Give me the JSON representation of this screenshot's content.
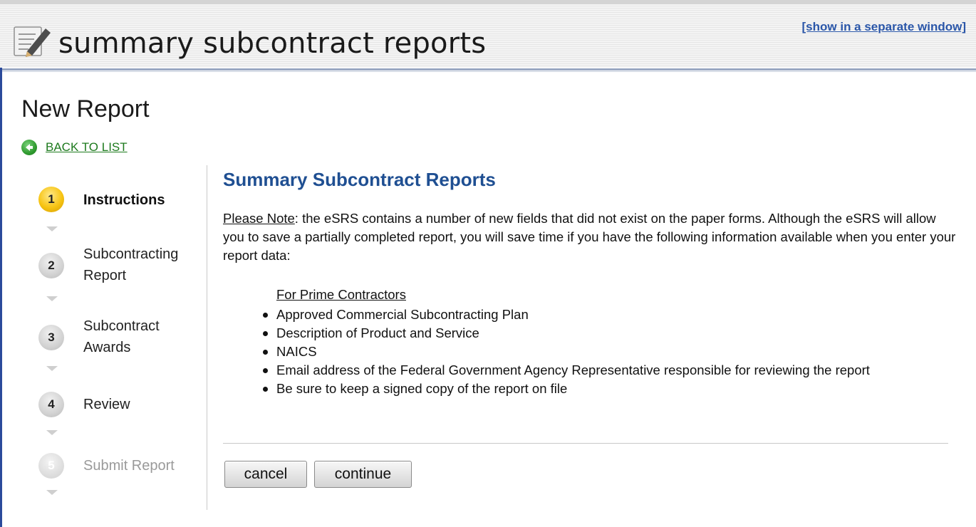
{
  "header": {
    "app_title": "summary subcontract reports",
    "popout_link": "[show in a separate window]",
    "icon": "notepad-pencil-icon"
  },
  "page": {
    "title": "New Report",
    "back_link": "BACK TO LIST",
    "back_icon": "back-arrow-icon"
  },
  "steps": [
    {
      "number": "1",
      "label": "Instructions",
      "state": "active"
    },
    {
      "number": "2",
      "label": "Subcontracting Report",
      "state": "normal"
    },
    {
      "number": "3",
      "label": "Subcontract Awards",
      "state": "normal"
    },
    {
      "number": "4",
      "label": "Review",
      "state": "normal"
    },
    {
      "number": "5",
      "label": "Submit Report",
      "state": "disabled"
    }
  ],
  "content": {
    "title": "Summary Subcontract Reports",
    "note_lead": "Please Note",
    "note_text": ": the eSRS contains a number of new fields that did not exist on the paper forms. Although the eSRS will allow you to save a partially completed report, you will save time if you have the following information available when you enter your report data:",
    "list_heading": "For Prime Contractors",
    "items": [
      "Approved Commercial Subcontracting Plan",
      "Description of Product and Service",
      "NAICS",
      "Email address of the Federal Government Agency Representative responsible for reviewing the report",
      "Be sure to keep a signed copy of the report on file"
    ]
  },
  "buttons": {
    "cancel": "cancel",
    "continue": "continue"
  },
  "colors": {
    "title_blue": "#1f4f92",
    "link_green": "#1d7a1d",
    "active_step": "#f7c413",
    "popout_link": "#2a56a8"
  }
}
